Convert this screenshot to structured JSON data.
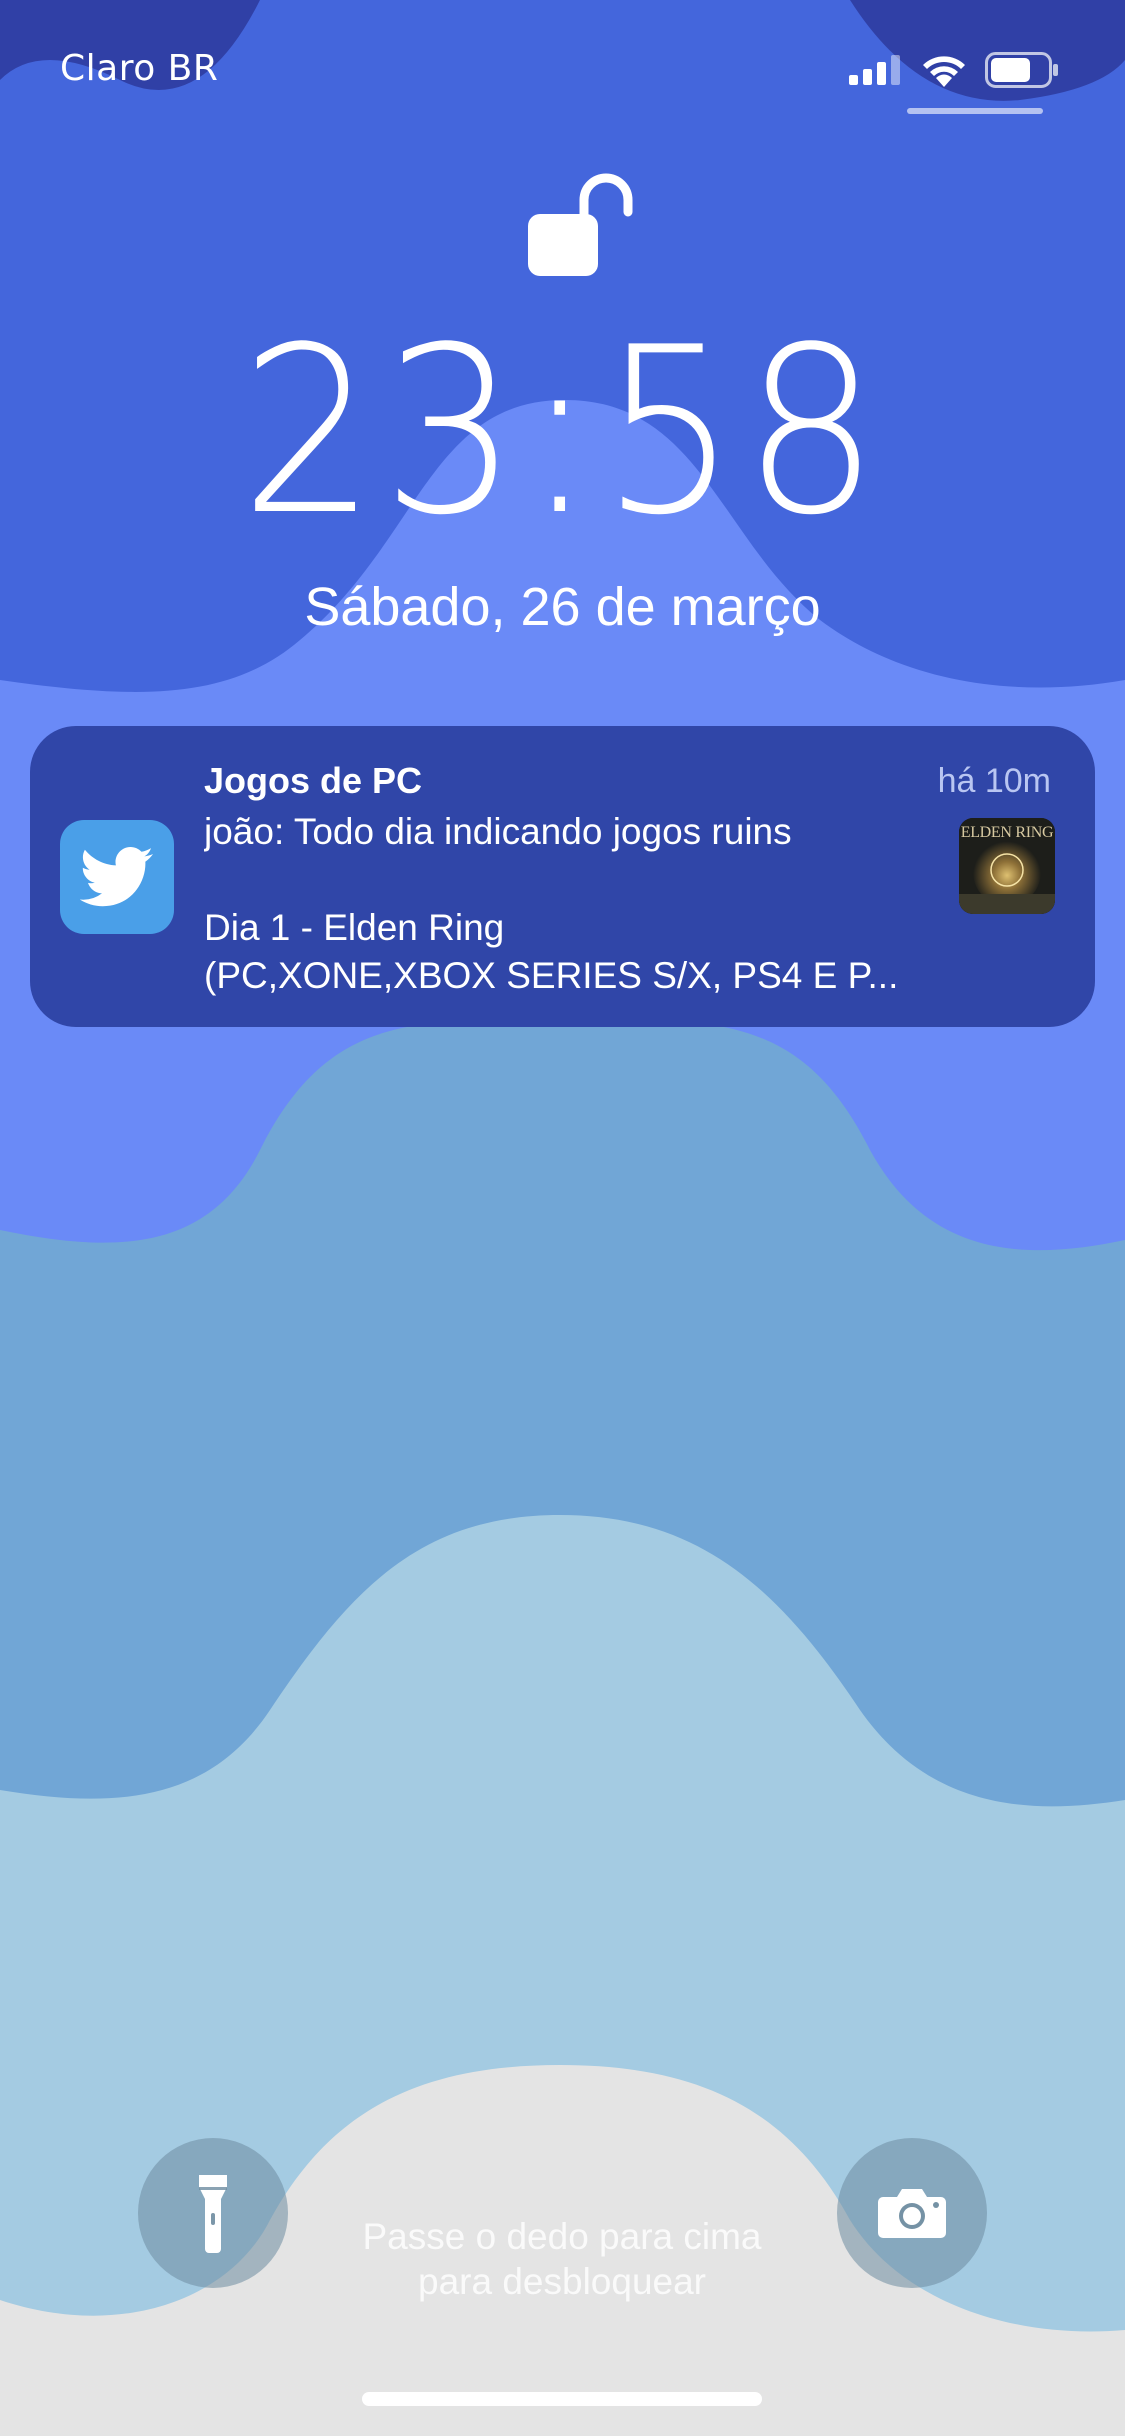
{
  "status_bar": {
    "carrier": "Claro BR",
    "signal_icon": "cellular-signal-icon",
    "wifi_icon": "wifi-icon",
    "battery_icon": "battery-icon",
    "battery_level": 0.7
  },
  "lock_screen": {
    "lock_state_icon": "unlocked-padlock-icon",
    "time": "23:58",
    "date": "Sábado, 26 de março"
  },
  "notification": {
    "app_icon": "twitter-bird-icon",
    "title": "Jogos de PC",
    "time_ago": "há 10m",
    "line1": "joão: Todo dia indicando jogos ruins",
    "line2": "Dia 1 - Elden Ring",
    "line3": "(PC,XONE,XBOX SERIES S/X, PS4 E P...",
    "thumbnail_label": "ELDEN RING"
  },
  "bottom": {
    "flashlight_icon": "flashlight-icon",
    "camera_icon": "camera-icon",
    "unlock_hint_line1": "Passe o dedo para cima",
    "unlock_hint_line2": "para desbloquear"
  },
  "colors": {
    "wallpaper_top": "#4466dc",
    "wallpaper_band2": "#6a8af7",
    "wallpaper_band3": "#71a6d6",
    "wallpaper_band4": "#a4cbe2",
    "wallpaper_bottom": "#e4e4e4",
    "notification_bg": "#3046a8",
    "twitter_blue": "#4a9fe8"
  }
}
